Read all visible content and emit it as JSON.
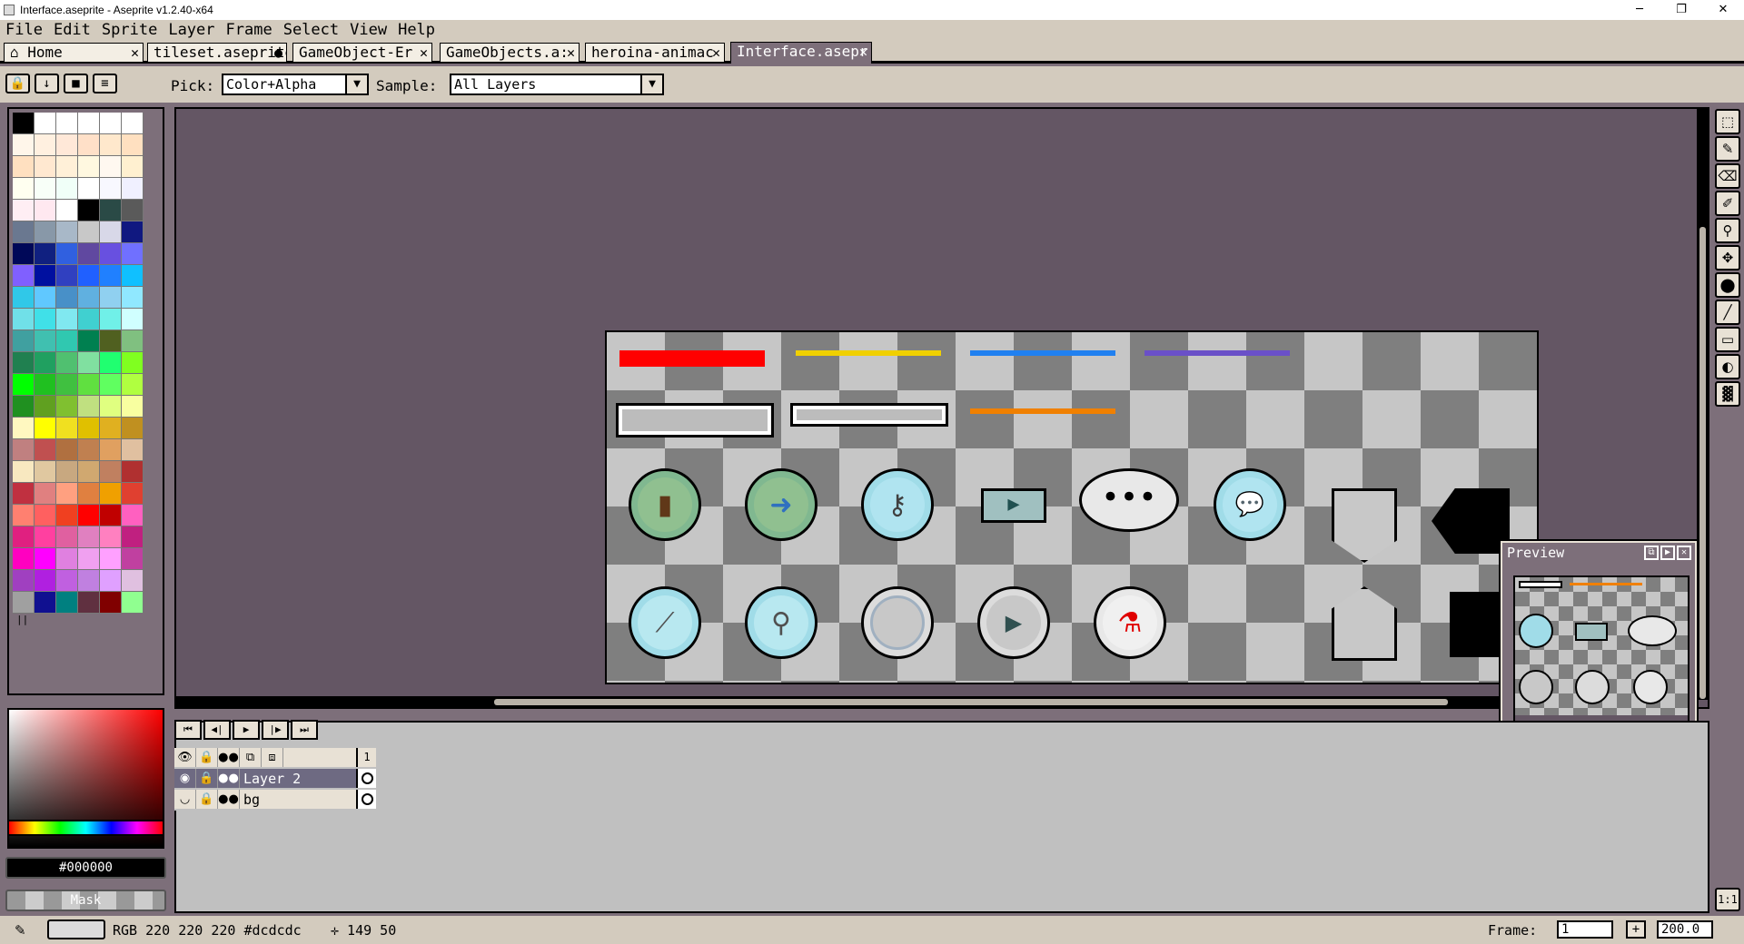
{
  "window": {
    "title": "Interface.aseprite - Aseprite v1.2.40-x64",
    "minimize": "─",
    "maximize": "❐",
    "close": "✕"
  },
  "menu": [
    "File",
    "Edit",
    "Sprite",
    "Layer",
    "Frame",
    "Select",
    "View",
    "Help"
  ],
  "tabs": [
    {
      "label": "⌂ Home",
      "close": "✕"
    },
    {
      "label": "tileset.aseprite",
      "close": "●"
    },
    {
      "label": "GameObject-Er",
      "close": "✕"
    },
    {
      "label": "GameObjects.a:",
      "close": "✕"
    },
    {
      "label": "heroina-animac",
      "close": "✕"
    },
    {
      "label": "Interface.asepr",
      "close": "✕"
    }
  ],
  "context": {
    "pick_label": "Pick:",
    "pick_value": "Color+Alpha",
    "sample_label": "Sample:",
    "sample_value": "All Layers",
    "icons": [
      "🔒",
      "↓",
      "■",
      "≡"
    ]
  },
  "palette": {
    "colors": [
      "#000000",
      "#ffffff",
      "#ffffff",
      "#ffffff",
      "#ffffff",
      "#ffffff",
      "#fff6ea",
      "#fff0e0",
      "#ffe8d8",
      "#ffe0c8",
      "#ffe8cc",
      "#ffe0c0",
      "#ffe0c0",
      "#ffe8d0",
      "#fff0d8",
      "#fff8e0",
      "#fff8f0",
      "#fff0d0",
      "#fffff0",
      "#f8fff8",
      "#f0fff8",
      "#ffffff",
      "#f8f8ff",
      "#f0f0ff",
      "#ffeef4",
      "#ffe8f0",
      "#ffffff",
      "#000000",
      "#2a4a46",
      "#5a5a5a",
      "#6a7890",
      "#8898a8",
      "#a8b8c8",
      "#c8c8c8",
      "#d8d8e8",
      "#101880",
      "#000858",
      "#102080",
      "#3060e0",
      "#6048a0",
      "#6850e0",
      "#7070ff",
      "#8060ff",
      "#0010a0",
      "#3040c0",
      "#2060ff",
      "#2080ff",
      "#10c0ff",
      "#30c8e8",
      "#60c8ff",
      "#4890c8",
      "#60b0e0",
      "#90d0f0",
      "#90e8ff",
      "#70e0e8",
      "#40e0e8",
      "#80e8f0",
      "#40d0d0",
      "#70f0e8",
      "#d0ffff",
      "#40a0a0",
      "#40c0b0",
      "#30c8b0",
      "#008050",
      "#506020",
      "#80c080",
      "#208050",
      "#20a060",
      "#50c070",
      "#80e0a0",
      "#20ff70",
      "#80ff20",
      "#00ff00",
      "#20c020",
      "#40c040",
      "#60e040",
      "#60ff60",
      "#b0ff40",
      "#209020",
      "#60a020",
      "#80c030",
      "#c0e080",
      "#e0ff80",
      "#f8ffa0",
      "#fff8c0",
      "#ffff00",
      "#f0e020",
      "#e0c000",
      "#e0b020",
      "#c09020",
      "#c08080",
      "#c05050",
      "#b07040",
      "#c08050",
      "#e0a060",
      "#e0c0a0",
      "#f8e8c0",
      "#e0c8a0",
      "#c8a880",
      "#d0a870",
      "#c08060",
      "#b03030",
      "#c03040",
      "#e08080",
      "#ffa080",
      "#e08040",
      "#f0a000",
      "#e04030",
      "#ff8070",
      "#ff6060",
      "#f04020",
      "#ff0000",
      "#c00000",
      "#ff60c0",
      "#e02080",
      "#ff40a0",
      "#e060a0",
      "#e080c0",
      "#ff80c0",
      "#c02080",
      "#ff00c0",
      "#ff00ff",
      "#e080e0",
      "#f0a0f0",
      "#ffa0ff",
      "#c040a0",
      "#a040c0",
      "#b020e0",
      "#c060e0",
      "#c080e0",
      "#e0a0ff",
      "#e0c0e0",
      "#a0a0a0",
      "#101090",
      "#008080",
      "#603040",
      "#800000",
      "#90ff90"
    ]
  },
  "fg_color": "#000000",
  "mask_label": "Mask",
  "tools": [
    "⬚",
    "✎",
    "⌫",
    "✐",
    "⚲",
    "✥",
    "⬤",
    "╱",
    "▭",
    "◐",
    "▓"
  ],
  "one_to_one": "1:1",
  "preview": {
    "title": "Preview"
  },
  "timeline": {
    "controls": [
      "⏮",
      "◀|",
      "▶",
      "|▶",
      "⏭"
    ],
    "frame_number": "1",
    "layers": [
      {
        "name": "Layer 2",
        "selected": true
      },
      {
        "name": "bg",
        "selected": false
      }
    ],
    "header_icons": [
      "👁",
      "🔒",
      "●●",
      "⧉",
      "⧈"
    ]
  },
  "status": {
    "color_text": "RGB 220 220 220 #dcdcdc",
    "coords": "✛ 149 50",
    "frame_label": "Frame:",
    "frame_value": "1",
    "plus": "+",
    "zoom": "200.0"
  }
}
